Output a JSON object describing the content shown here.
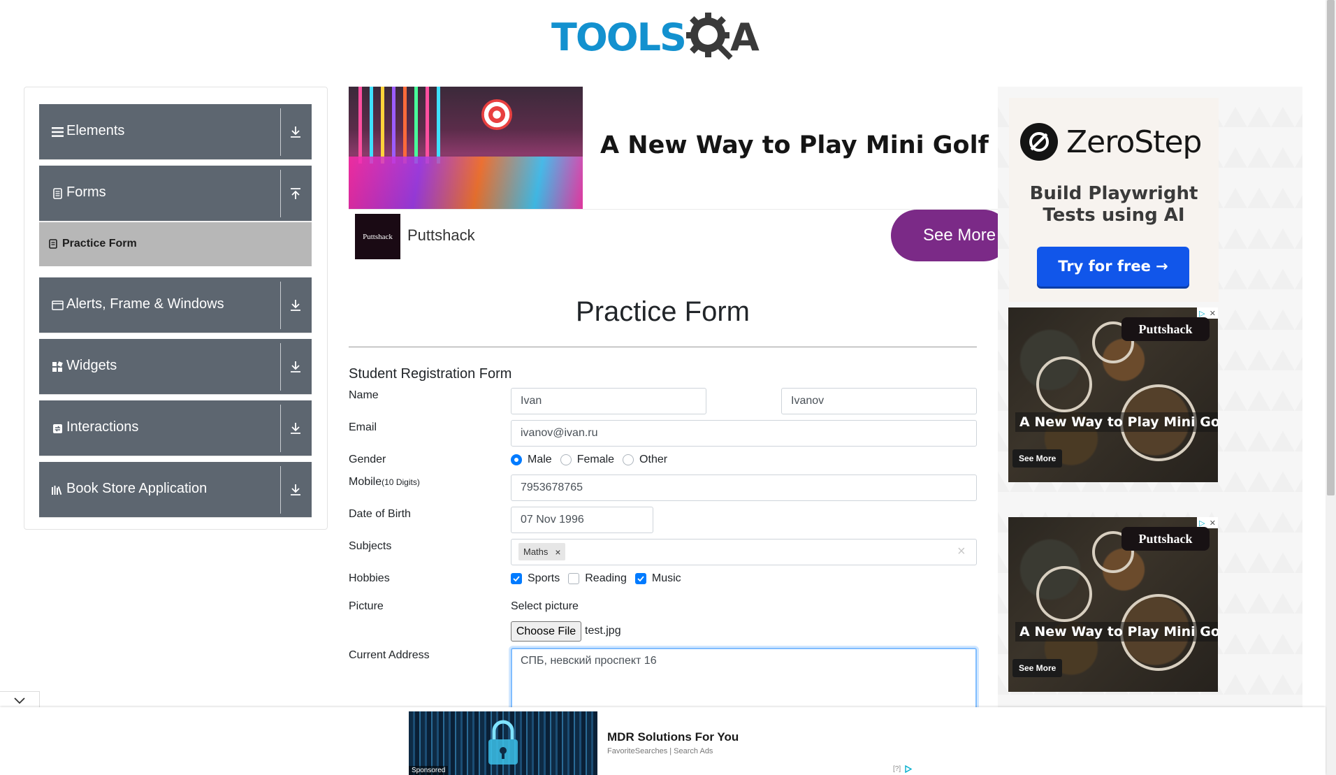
{
  "header": {
    "logo_text": "TOOLS",
    "logo_suffix": "A"
  },
  "sidebar": {
    "groups": [
      {
        "label": "Elements",
        "icon": "hamburger-icon",
        "arrow": "down"
      },
      {
        "label": "Forms",
        "icon": "document-icon",
        "arrow": "up"
      },
      {
        "label": "Alerts, Frame & Windows",
        "icon": "window-icon",
        "arrow": "down"
      },
      {
        "label": "Widgets",
        "icon": "widgets-icon",
        "arrow": "down"
      },
      {
        "label": "Interactions",
        "icon": "interactions-icon",
        "arrow": "down"
      },
      {
        "label": "Book Store Application",
        "icon": "books-icon",
        "arrow": "down"
      }
    ],
    "active_item": "Practice Form"
  },
  "top_ad": {
    "headline": "A New Way to Play Mini Golf",
    "brand_logo_text": "Puttshack",
    "brand_name": "Puttshack",
    "cta": "See More"
  },
  "form": {
    "page_title": "Practice Form",
    "heading": "Student Registration Form",
    "labels": {
      "name": "Name",
      "email": "Email",
      "gender": "Gender",
      "mobile": "Mobile",
      "mobile_hint": "(10 Digits)",
      "dob": "Date of Birth",
      "subjects": "Subjects",
      "hobbies": "Hobbies",
      "picture": "Picture",
      "address": "Current Address"
    },
    "first_name": "Ivan",
    "last_name": "Ivanov",
    "email": "ivanov@ivan.ru",
    "gender_options": [
      "Male",
      "Female",
      "Other"
    ],
    "gender_selected": "Male",
    "mobile": "7953678765",
    "dob": "07 Nov 1996",
    "subjects": [
      "Maths"
    ],
    "subject_remove": "×",
    "subjects_clear": "×",
    "hobbies": [
      {
        "label": "Sports",
        "checked": true
      },
      {
        "label": "Reading",
        "checked": false
      },
      {
        "label": "Music",
        "checked": true
      }
    ],
    "picture_prompt": "Select picture",
    "choose_file": "Choose File",
    "file_name": "test.jpg",
    "address": "СПБ, невский проспект 16"
  },
  "right_ads": {
    "zerostep": {
      "brand": "ZeroStep",
      "tagline": "Build Playwright Tests using AI",
      "cta": "Try for free →"
    },
    "food_ads": [
      {
        "badge": "Puttshack",
        "headline": "A New Way to Play Mini Golf",
        "cta": "See More"
      },
      {
        "badge": "Puttshack",
        "headline": "A New Way to Play Mini Golf",
        "cta": "See More"
      }
    ],
    "adchoice_q": "▷",
    "adchoice_x": "✕"
  },
  "bottom_ad": {
    "sponsored": "Sponsored",
    "title": "MDR Solutions For You",
    "subtitle": "FavoriteSearches | Search Ads",
    "info": "[?]"
  },
  "colors": {
    "accent": "#007bff",
    "sidebar_bg": "#5d6670",
    "active_item_bg": "#b7b7b7",
    "cta_purple": "#7b2a87",
    "zerostep_blue": "#1156ea"
  }
}
